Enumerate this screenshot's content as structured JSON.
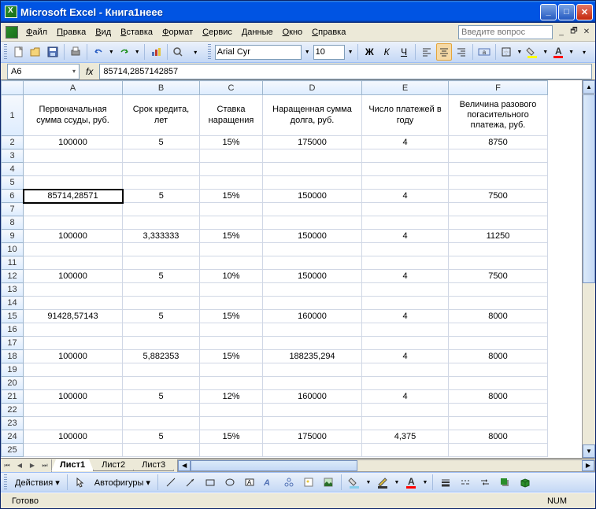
{
  "title": "Microsoft Excel - Книга1неее",
  "menu": [
    "Файл",
    "Правка",
    "Вид",
    "Вставка",
    "Формат",
    "Сервис",
    "Данные",
    "Окно",
    "Справка"
  ],
  "help_placeholder": "Введите вопрос",
  "font_name": "Arial Cyr",
  "font_size": "10",
  "name_box": "A6",
  "formula": "85714,2857142857",
  "cols": [
    "A",
    "B",
    "C",
    "D",
    "E",
    "F"
  ],
  "rows": {
    "1": {
      "A": "Первоначальная сумма ссуды, руб.",
      "B": "Срок кредита, лет",
      "C": "Ставка наращения",
      "D": "Наращенная сумма долга, руб.",
      "E": "Число платежей в году",
      "F": "Величина разового погасительного платежа, руб."
    },
    "2": {
      "A": "100000",
      "B": "5",
      "C": "15%",
      "D": "175000",
      "E": "4",
      "F": "8750"
    },
    "3": {},
    "4": {},
    "5": {},
    "6": {
      "A": "85714,28571",
      "B": "5",
      "C": "15%",
      "D": "150000",
      "E": "4",
      "F": "7500"
    },
    "7": {},
    "8": {},
    "9": {
      "A": "100000",
      "B": "3,333333",
      "C": "15%",
      "D": "150000",
      "E": "4",
      "F": "11250"
    },
    "10": {},
    "11": {},
    "12": {
      "A": "100000",
      "B": "5",
      "C": "10%",
      "D": "150000",
      "E": "4",
      "F": "7500"
    },
    "13": {},
    "14": {},
    "15": {
      "A": "91428,57143",
      "B": "5",
      "C": "15%",
      "D": "160000",
      "E": "4",
      "F": "8000"
    },
    "16": {},
    "17": {},
    "18": {
      "A": "100000",
      "B": "5,882353",
      "C": "15%",
      "D": "188235,294",
      "E": "4",
      "F": "8000"
    },
    "19": {},
    "20": {},
    "21": {
      "A": "100000",
      "B": "5",
      "C": "12%",
      "D": "160000",
      "E": "4",
      "F": "8000"
    },
    "22": {},
    "23": {},
    "24": {
      "A": "100000",
      "B": "5",
      "C": "15%",
      "D": "175000",
      "E": "4,375",
      "F": "8000"
    },
    "25": {}
  },
  "selected_cell": "A6",
  "tabs": [
    "Лист1",
    "Лист2",
    "Лист3"
  ],
  "active_tab": 0,
  "draw_label": "Действия",
  "autoshapes": "Автофигуры",
  "status": "Готово",
  "num": "NUM"
}
